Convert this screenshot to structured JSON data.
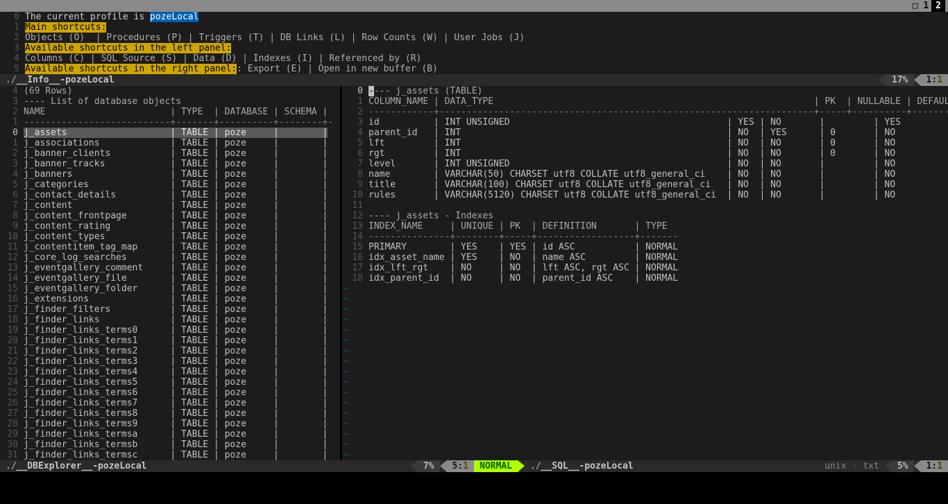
{
  "tabline": {
    "indicator": "□ 1",
    "count": "2"
  },
  "info": {
    "lines": [
      {
        "n": "0",
        "pre": "The current profile is ",
        "profile": "pozeLocal"
      },
      {
        "n": "1",
        "hl": "Main shortcuts:"
      },
      {
        "n": "2",
        "text": "Objects (O)  | Procedures (P) | Triggers (T) | DB Links (L) | Row Counts (W) | User Jobs (J)"
      },
      {
        "n": "3",
        "hl": "Available shortcuts in the left panel:"
      },
      {
        "n": "4",
        "text": "Columns (C) | SQL Source (S) | Data (D) | Indexes (I) | Referenced by (R)"
      },
      {
        "n": "5",
        "hl": "Available shortcuts in the right panel:",
        "after": ": Export (E) | Open in new buffer (B)"
      }
    ],
    "status": {
      "name": "__Info__-pozeLocal",
      "pct": "17%",
      "pos_r": "1",
      "pos_c": "1"
    }
  },
  "left": {
    "header_rows": "(69 Rows)",
    "header_title": "---- List of database objects",
    "cols": "NAME                       | TYPE  | DATABASE | SCHEMA |",
    "dash": "---------------------------+-------+----------+--------+-",
    "selected_index": 0,
    "items": [
      [
        "j_assets",
        "TABLE",
        "poze"
      ],
      [
        "j_associations",
        "TABLE",
        "poze"
      ],
      [
        "j_banner_clients",
        "TABLE",
        "poze"
      ],
      [
        "j_banner_tracks",
        "TABLE",
        "poze"
      ],
      [
        "j_banners",
        "TABLE",
        "poze"
      ],
      [
        "j_categories",
        "TABLE",
        "poze"
      ],
      [
        "j_contact_details",
        "TABLE",
        "poze"
      ],
      [
        "j_content",
        "TABLE",
        "poze"
      ],
      [
        "j_content_frontpage",
        "TABLE",
        "poze"
      ],
      [
        "j_content_rating",
        "TABLE",
        "poze"
      ],
      [
        "j_content_types",
        "TABLE",
        "poze"
      ],
      [
        "j_contentitem_tag_map",
        "TABLE",
        "poze"
      ],
      [
        "j_core_log_searches",
        "TABLE",
        "poze"
      ],
      [
        "j_eventgallery_comment",
        "TABLE",
        "poze"
      ],
      [
        "j_eventgallery_file",
        "TABLE",
        "poze"
      ],
      [
        "j_eventgallery_folder",
        "TABLE",
        "poze"
      ],
      [
        "j_extensions",
        "TABLE",
        "poze"
      ],
      [
        "j_finder_filters",
        "TABLE",
        "poze"
      ],
      [
        "j_finder_links",
        "TABLE",
        "poze"
      ],
      [
        "j_finder_links_terms0",
        "TABLE",
        "poze"
      ],
      [
        "j_finder_links_terms1",
        "TABLE",
        "poze"
      ],
      [
        "j_finder_links_terms2",
        "TABLE",
        "poze"
      ],
      [
        "j_finder_links_terms3",
        "TABLE",
        "poze"
      ],
      [
        "j_finder_links_terms4",
        "TABLE",
        "poze"
      ],
      [
        "j_finder_links_terms5",
        "TABLE",
        "poze"
      ],
      [
        "j_finder_links_terms6",
        "TABLE",
        "poze"
      ],
      [
        "j_finder_links_terms7",
        "TABLE",
        "poze"
      ],
      [
        "j_finder_links_terms8",
        "TABLE",
        "poze"
      ],
      [
        "j_finder_links_terms9",
        "TABLE",
        "poze"
      ],
      [
        "j_finder_links_termsa",
        "TABLE",
        "poze"
      ],
      [
        "j_finder_links_termsb",
        "TABLE",
        "poze"
      ],
      [
        "j_finder_links_termsc",
        "TABLE",
        "poze"
      ]
    ],
    "status": {
      "name": "__DBExplorer__-pozeLocal",
      "pct": "7%",
      "pos_r": "5",
      "pos_c": "1"
    }
  },
  "right": {
    "title": "--- j_assets (TABLE)",
    "col_header": "COLUMN_NAME | DATA_TYPE                                                           | PK  | NULLABLE | DEFAULT | AUTOINCREM",
    "dash": "------------+---------------------------------------------------------------------+-----+----------+---------+--------",
    "columns": [
      [
        "id",
        "INT UNSIGNED",
        "YES",
        "NO",
        "",
        "YES"
      ],
      [
        "parent_id",
        "INT",
        "NO",
        "YES",
        "0",
        "NO"
      ],
      [
        "lft",
        "INT",
        "NO",
        "NO",
        "0",
        "NO"
      ],
      [
        "rgt",
        "INT",
        "NO",
        "NO",
        "0",
        "NO"
      ],
      [
        "level",
        "INT UNSIGNED",
        "NO",
        "NO",
        "",
        "NO"
      ],
      [
        "name",
        "VARCHAR(50) CHARSET utf8 COLLATE utf8_general_ci",
        "NO",
        "NO",
        "",
        "NO"
      ],
      [
        "title",
        "VARCHAR(100) CHARSET utf8 COLLATE utf8_general_ci",
        "NO",
        "NO",
        "",
        "NO"
      ],
      [
        "rules",
        "VARCHAR(5120) CHARSET utf8 COLLATE utf8_general_ci",
        "NO",
        "NO",
        "",
        "NO"
      ]
    ],
    "idx_title": "---- j_assets - Indexes",
    "idx_header": "INDEX_NAME     | UNIQUE | PK  | DEFINITION       | TYPE",
    "idx_dash": "---------------+--------+-----+------------------+-------",
    "indexes": [
      [
        "PRIMARY",
        "YES",
        "YES",
        "id ASC",
        "NORMAL"
      ],
      [
        "idx_asset_name",
        "YES",
        "NO",
        "name ASC",
        "NORMAL"
      ],
      [
        "idx_lft_rgt",
        "NO",
        "NO",
        "lft ASC, rgt ASC",
        "NORMAL"
      ],
      [
        "idx_parent_id",
        "NO",
        "NO",
        "parent_id ASC",
        "NORMAL"
      ]
    ],
    "status": {
      "mode": "NORMAL",
      "name": "__SQL__-pozeLocal",
      "unix": "unix",
      "ft": "txt",
      "pct": "5%",
      "pos_r": "1",
      "pos_c": "1"
    }
  }
}
